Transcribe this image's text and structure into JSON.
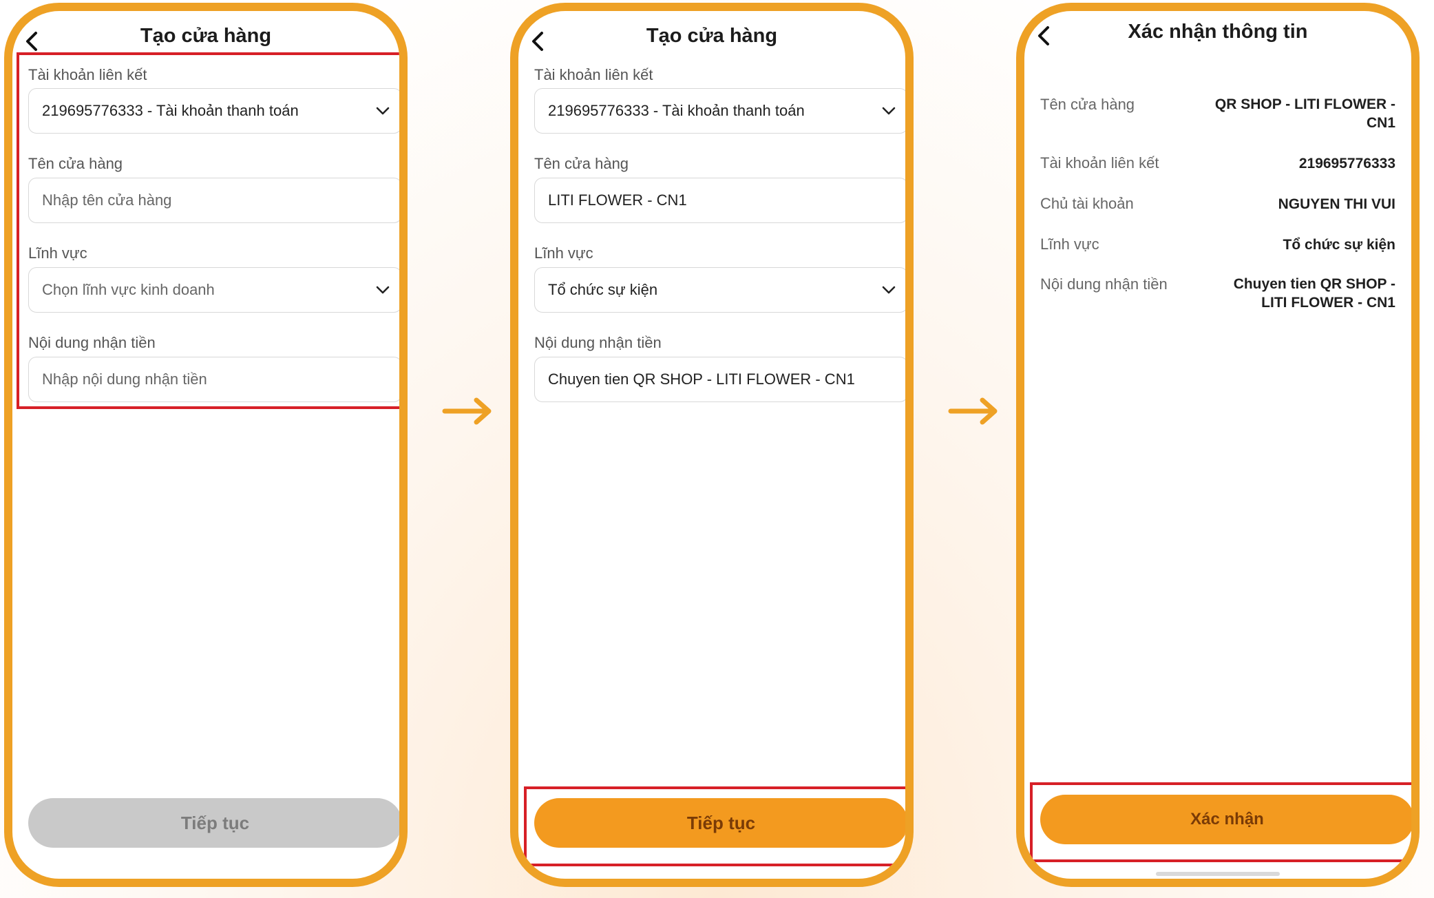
{
  "colors": {
    "accent": "#eea125",
    "highlight": "#d72027",
    "button": "#f39a1f",
    "disabled": "#c9c9c9"
  },
  "screen1": {
    "title": "Tạo cửa hàng",
    "back_icon": "chevron-left-icon",
    "account_label": "Tài khoản liên kết",
    "account_value": "219695776333 - Tài khoản thanh toán",
    "store_label": "Tên cửa hàng",
    "store_placeholder": "Nhập tên cửa hàng",
    "field_label": "Lĩnh vực",
    "field_placeholder": "Chọn lĩnh vực kinh doanh",
    "content_label": "Nội dung nhận tiền",
    "content_placeholder": "Nhập nội dung nhận tiền",
    "button_label": "Tiếp tục"
  },
  "screen2": {
    "title": "Tạo cửa hàng",
    "back_icon": "chevron-left-icon",
    "account_label": "Tài khoản liên kết",
    "account_value": "219695776333 - Tài khoản thanh toán",
    "store_label": "Tên cửa hàng",
    "store_value": "LITI FLOWER - CN1",
    "field_label": "Lĩnh vực",
    "field_value": "Tổ chức sự kiện",
    "content_label": "Nội dung nhận tiền",
    "content_value": "Chuyen tien QR SHOP - LITI FLOWER - CN1",
    "button_label": "Tiếp tục"
  },
  "screen3": {
    "title": "Xác nhận thông tin",
    "back_icon": "chevron-left-icon",
    "rows": [
      {
        "label": "Tên cửa hàng",
        "value_line1": "QR SHOP - LITI FLOWER -",
        "value_line2": "CN1"
      },
      {
        "label": "Tài khoản liên kết",
        "value": "219695776333"
      },
      {
        "label": "Chủ tài khoản",
        "value": "NGUYEN THI VUI"
      },
      {
        "label": "Lĩnh vực",
        "value": "Tổ chức sự kiện"
      },
      {
        "label": "Nội dung nhận tiền",
        "value_line1": "Chuyen tien QR SHOP -",
        "value_line2": "LITI FLOWER - CN1"
      }
    ],
    "button_label": "Xác nhận"
  },
  "arrows": [
    "arrow-right-icon",
    "arrow-right-icon"
  ]
}
